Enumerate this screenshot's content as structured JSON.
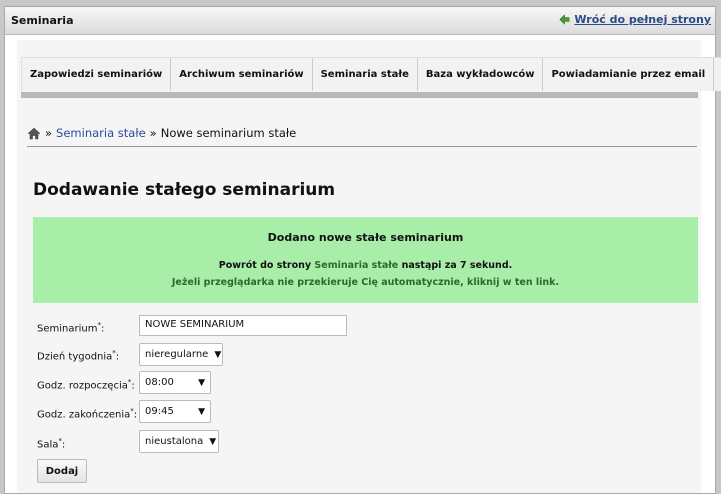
{
  "header": {
    "site_title": "Seminaria",
    "full_site_link": "Wróć do pełnej strony"
  },
  "menu": [
    "Zapowiedzi seminariów",
    "Archiwum seminariów",
    "Seminaria stałe",
    "Baza wykładowców",
    "Powiadamianie przez email",
    "⇓"
  ],
  "breadcrumb": {
    "sep1": "»",
    "link": "Seminaria stałe",
    "sep2": "»",
    "current": "Nowe seminarium stałe"
  },
  "page_title": "Dodawanie stałego seminarium",
  "message": {
    "heading": "Dodano nowe stałe seminarium",
    "line1_pre": "Powrót do strony ",
    "line1_link": "Seminaria stałe",
    "line1_post": " nastąpi za 7 sekund.",
    "line2": "Jeżeli przeglądarka nie przekieruje Cię automatycznie, kliknij w ten link."
  },
  "form": {
    "seminar_label": "Seminarium",
    "seminar_value": "NOWE SEMINARIUM",
    "day_label": "Dzień tygodnia",
    "day_value": "nieregularne",
    "start_label": "Godz. rozpoczęcia",
    "start_value": "08:00",
    "end_label": "Godz. zakończenia",
    "end_value": "09:45",
    "room_label": "Sala",
    "room_value": "nieustalona",
    "required_mark": "*",
    "colon": ":",
    "submit": "Dodaj"
  },
  "colors": {
    "success_bg": "#a8eea9",
    "link": "#2a4aa0"
  }
}
